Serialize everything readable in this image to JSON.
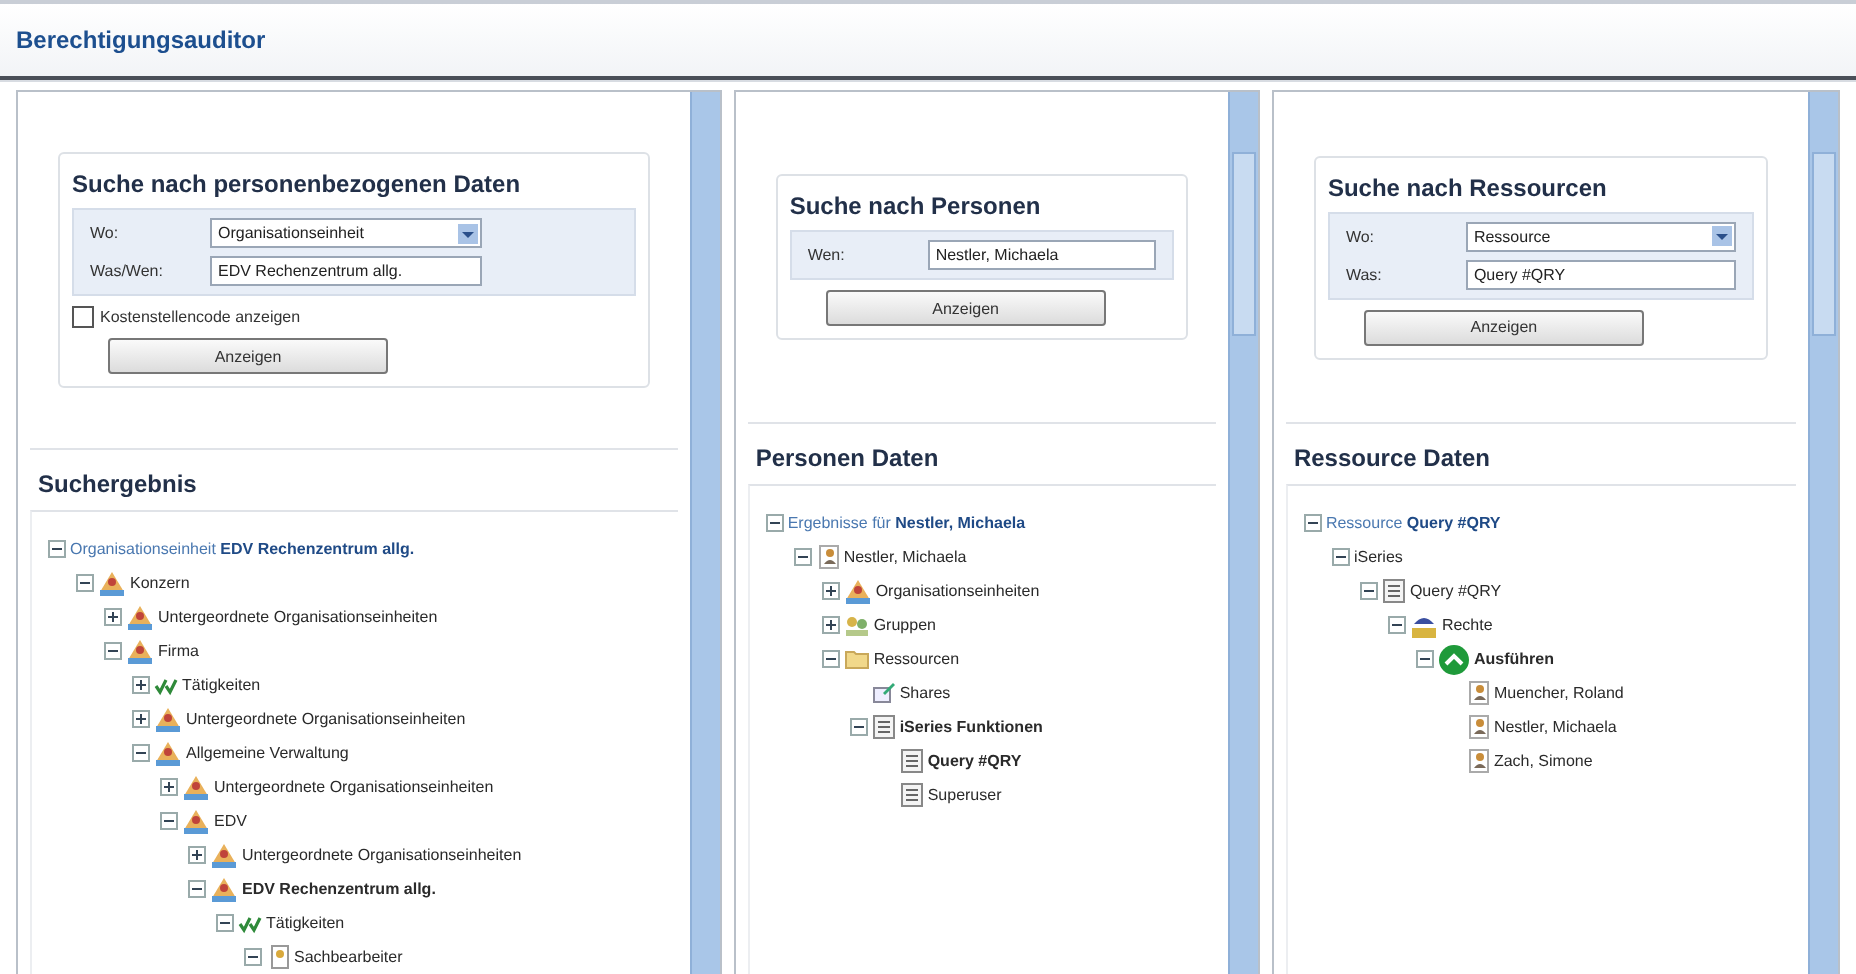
{
  "window": {
    "title": "Berechtigungsauditor"
  },
  "columns": [
    {
      "search": {
        "title": "Suche nach personenbezogenen Daten",
        "fields": [
          {
            "label": "Wo:",
            "kind": "select",
            "value": "Organisationseinheit"
          },
          {
            "label": "Was/Wen:",
            "kind": "text",
            "value": "EDV Rechenzentrum allg."
          }
        ],
        "checkbox": {
          "label": "Kostenstellencode anzeigen",
          "checked": false
        },
        "button": "Anzeigen"
      },
      "results": {
        "title": "Suchergebnis",
        "tree": [
          {
            "text": "Organisationseinheit **EDV Rechenzentrum allg.**",
            "kind": "root",
            "expanded": true,
            "children": [
              {
                "text": "Konzern",
                "kind": "org",
                "expanded": true,
                "children": [
                  {
                    "text": "Untergeordnete Organisationseinheiten",
                    "kind": "org",
                    "expanded": false
                  },
                  {
                    "text": "Firma",
                    "kind": "org",
                    "expanded": true,
                    "children": [
                      {
                        "text": "Tätigkeiten",
                        "kind": "activity",
                        "expanded": false
                      },
                      {
                        "text": "Untergeordnete Organisationseinheiten",
                        "kind": "org",
                        "expanded": false
                      },
                      {
                        "text": "Allgemeine Verwaltung",
                        "kind": "org",
                        "expanded": true,
                        "children": [
                          {
                            "text": "Untergeordnete Organisationseinheiten",
                            "kind": "org",
                            "expanded": false
                          },
                          {
                            "text": "EDV",
                            "kind": "org",
                            "expanded": true,
                            "children": [
                              {
                                "text": "Untergeordnete Organisationseinheiten",
                                "kind": "org",
                                "expanded": false
                              },
                              {
                                "text": "EDV Rechenzentrum allg.",
                                "kind": "org",
                                "expanded": true,
                                "bold": true,
                                "children": [
                                  {
                                    "text": "Tätigkeiten",
                                    "kind": "activity",
                                    "expanded": true,
                                    "children": [
                                      {
                                        "text": "Sachbearbeiter",
                                        "kind": "role",
                                        "expanded": true
                                      }
                                    ]
                                  }
                                ]
                              }
                            ]
                          }
                        ]
                      }
                    ]
                  }
                ]
              }
            ]
          }
        ]
      },
      "scroll": false
    },
    {
      "search": {
        "title": "Suche nach Personen",
        "fields": [
          {
            "label": "Wen:",
            "kind": "text",
            "value": "Nestler, Michaela"
          }
        ],
        "button": "Anzeigen"
      },
      "results": {
        "title": "Personen Daten",
        "tree": [
          {
            "text": "Ergebnisse für **Nestler, Michaela**",
            "kind": "root",
            "expanded": true,
            "children": [
              {
                "text": "Nestler, Michaela",
                "kind": "person",
                "expanded": true,
                "children": [
                  {
                    "text": "Organisationseinheiten",
                    "kind": "org",
                    "expanded": false
                  },
                  {
                    "text": "Gruppen",
                    "kind": "group",
                    "expanded": false
                  },
                  {
                    "text": "Ressourcen",
                    "kind": "resource",
                    "expanded": true,
                    "children": [
                      {
                        "text": "Shares",
                        "kind": "share"
                      },
                      {
                        "text": "iSeries Funktionen",
                        "kind": "list",
                        "expanded": true,
                        "bold": true,
                        "children": [
                          {
                            "text": "Query #QRY",
                            "kind": "list",
                            "bold": true
                          },
                          {
                            "text": "Superuser",
                            "kind": "list"
                          }
                        ]
                      }
                    ]
                  }
                ]
              }
            ]
          }
        ]
      },
      "scroll": true
    },
    {
      "search": {
        "title": "Suche nach Ressourcen",
        "fields": [
          {
            "label": "Wo:",
            "kind": "select",
            "value": "Ressource"
          },
          {
            "label": "Was:",
            "kind": "text",
            "value": "Query #QRY"
          }
        ],
        "button": "Anzeigen"
      },
      "results": {
        "title": "Ressource Daten",
        "tree": [
          {
            "text": "Ressource **Query #QRY**",
            "kind": "root",
            "expanded": true,
            "children": [
              {
                "text": "iSeries",
                "kind": "plain",
                "expanded": true,
                "children": [
                  {
                    "text": "Query #QRY",
                    "kind": "list",
                    "expanded": true,
                    "children": [
                      {
                        "text": "Rechte",
                        "kind": "right",
                        "expanded": true,
                        "children": [
                          {
                            "text": "Ausführen",
                            "kind": "execute",
                            "expanded": true,
                            "bold": true,
                            "children": [
                              {
                                "text": "Muencher, Roland",
                                "kind": "person"
                              },
                              {
                                "text": "Nestler, Michaela",
                                "kind": "person"
                              },
                              {
                                "text": "Zach, Simone",
                                "kind": "person"
                              }
                            ]
                          }
                        ]
                      }
                    ]
                  }
                ]
              }
            ]
          }
        ]
      },
      "scroll": true
    }
  ]
}
